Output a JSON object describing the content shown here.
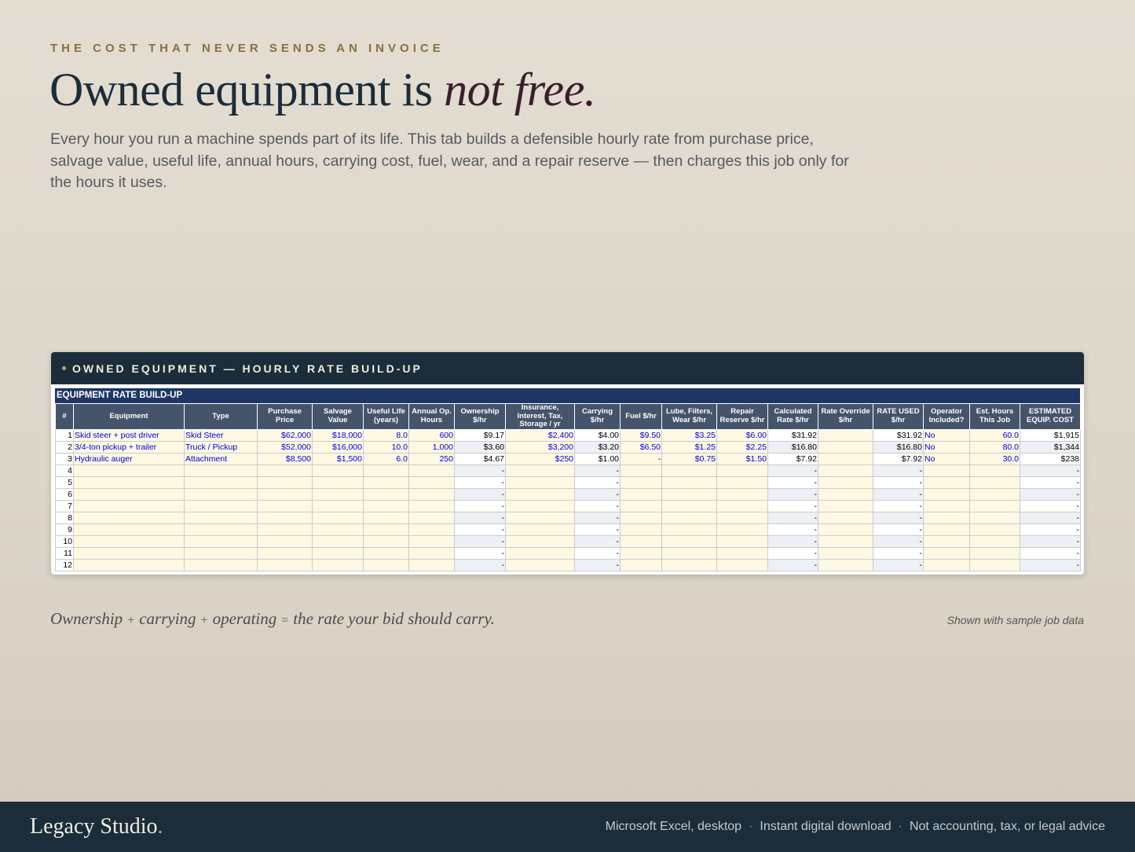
{
  "eyebrow": "THE COST THAT NEVER SENDS AN INVOICE",
  "headline": {
    "plain": "Owned equipment is ",
    "emph": "not free."
  },
  "lede": "Every hour you run a machine spends part of its life. This tab builds a defensible hourly rate from purchase price, salvage value, useful life, annual hours, carrying cost, fuel, wear, and a repair reserve — then charges this job only for the hours it uses.",
  "card": {
    "title": "OWNED EQUIPMENT — HOURLY RATE BUILD-UP",
    "sheet_title": "EQUIPMENT RATE BUILD-UP",
    "columns": [
      "#",
      "Equipment",
      "Type",
      "Purchase Price",
      "Salvage Value",
      "Useful Life (years)",
      "Annual Op. Hours",
      "Ownership $/hr",
      "Insurance, Interest, Tax, Storage / yr",
      "Carrying $/hr",
      "Fuel $/hr",
      "Lube, Filters, Wear $/hr",
      "Repair Reserve $/hr",
      "Calculated Rate $/hr",
      "Rate Override $/hr",
      "RATE USED $/hr",
      "Operator Included?",
      "Est. Hours This Job",
      "ESTIMATED EQUIP. COST"
    ],
    "rows": [
      [
        "1",
        "Skid steer + post driver",
        "Skid Steer",
        "$62,000",
        "$18,000",
        "8.0",
        "600",
        "$9.17",
        "$2,400",
        "$4.00",
        "$9.50",
        "$3.25",
        "$6.00",
        "$31.92",
        "",
        "$31.92",
        "No",
        "60.0",
        "$1,915"
      ],
      [
        "2",
        "3/4-ton pickup + trailer",
        "Truck / Pickup",
        "$52,000",
        "$16,000",
        "10.0",
        "1,000",
        "$3.60",
        "$3,200",
        "$3.20",
        "$6.50",
        "$1.25",
        "$2.25",
        "$16.80",
        "",
        "$16.80",
        "No",
        "80.0",
        "$1,344"
      ],
      [
        "3",
        "Hydraulic auger",
        "Attachment",
        "$8,500",
        "$1,500",
        "6.0",
        "250",
        "$4.67",
        "$250",
        "$1.00",
        "-",
        "$0.75",
        "$1.50",
        "$7.92",
        "",
        "$7.92",
        "No",
        "30.0",
        "$238"
      ],
      [
        "4",
        "",
        "",
        "",
        "",
        "",
        "",
        "-",
        "",
        "-",
        "",
        "",
        "",
        "-",
        "",
        "-",
        "",
        "",
        "-"
      ],
      [
        "5",
        "",
        "",
        "",
        "",
        "",
        "",
        "-",
        "",
        "-",
        "",
        "",
        "",
        "-",
        "",
        "-",
        "",
        "",
        "-"
      ],
      [
        "6",
        "",
        "",
        "",
        "",
        "",
        "",
        "-",
        "",
        "-",
        "",
        "",
        "",
        "-",
        "",
        "-",
        "",
        "",
        "-"
      ],
      [
        "7",
        "",
        "",
        "",
        "",
        "",
        "",
        "-",
        "",
        "-",
        "",
        "",
        "",
        "-",
        "",
        "-",
        "",
        "",
        "-"
      ],
      [
        "8",
        "",
        "",
        "",
        "",
        "",
        "",
        "-",
        "",
        "-",
        "",
        "",
        "",
        "-",
        "",
        "-",
        "",
        "",
        "-"
      ],
      [
        "9",
        "",
        "",
        "",
        "",
        "",
        "",
        "-",
        "",
        "-",
        "",
        "",
        "",
        "-",
        "",
        "-",
        "",
        "",
        "-"
      ],
      [
        "10",
        "",
        "",
        "",
        "",
        "",
        "",
        "-",
        "",
        "-",
        "",
        "",
        "",
        "-",
        "",
        "-",
        "",
        "",
        "-"
      ],
      [
        "11",
        "",
        "",
        "",
        "",
        "",
        "",
        "-",
        "",
        "-",
        "",
        "",
        "",
        "-",
        "",
        "-",
        "",
        "",
        "-"
      ],
      [
        "12",
        "",
        "",
        "",
        "",
        "",
        "",
        "-",
        "",
        "-",
        "",
        "",
        "",
        "-",
        "",
        "-",
        "",
        "",
        "-"
      ]
    ]
  },
  "formula": {
    "a": "Ownership",
    "op1": "+",
    "b": "carrying",
    "op2": "+",
    "c": "operating",
    "op3": "=",
    "d": "the rate your bid should carry."
  },
  "note": "Shown with sample job data",
  "footer": {
    "brand": "Legacy Studio",
    "brand_dot": ".",
    "meta": [
      "Microsoft Excel, desktop",
      "Instant digital download",
      "Not accounting, tax, or legal advice"
    ],
    "sep": "·"
  },
  "colors": {
    "navy": "#1b2d3a",
    "gold": "#c9a560",
    "input_fill": "#fff8e2",
    "input_text": "#0000ee",
    "header_fill": "#44546a"
  }
}
